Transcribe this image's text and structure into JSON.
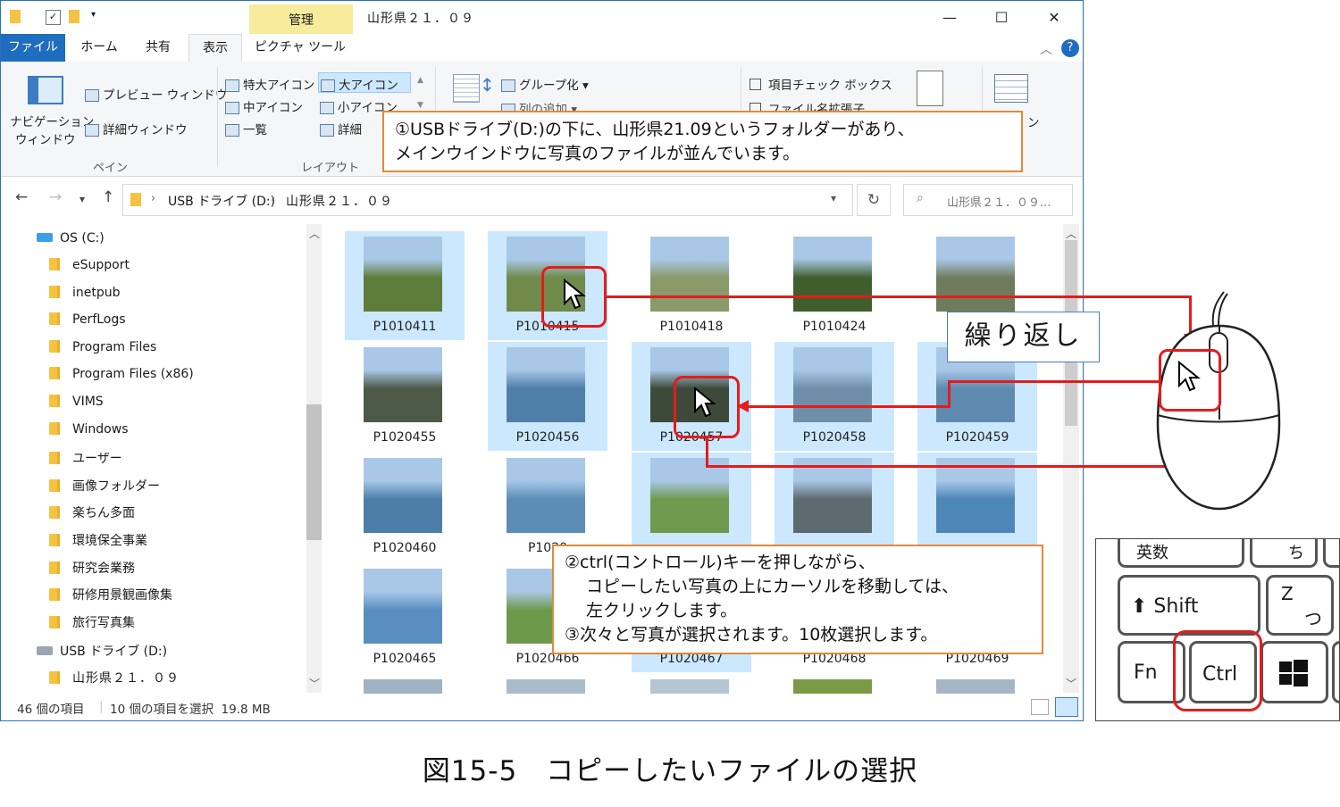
{
  "window": {
    "title": "山形県２１．０９",
    "context_tab": "管理",
    "caption_minimize": "—",
    "caption_maximize": "☐",
    "caption_close": "✕"
  },
  "ribbon_tabs": [
    "ファイル",
    "ホーム",
    "共有",
    "表示",
    "ピクチャ ツール"
  ],
  "ribbon": {
    "navigation_pane_line1": "ナビゲーション",
    "navigation_pane_line2": "ウィンドウ",
    "preview_pane": "プレビュー ウィンドウ",
    "details_pane": "詳細ウィンドウ",
    "pane_group": "ペイン",
    "extra_large_icons": "特大アイコン",
    "large_icons": "大アイコン",
    "medium_icons": "中アイコン",
    "small_icons": "小アイコン",
    "list": "一覧",
    "details": "詳細",
    "layout_group": "レイアウト",
    "group_by": "グループ化",
    "add_columns": "列の追加",
    "item_checkboxes": "項目チェック ボックス",
    "file_extensions": "ファイル名拡張子",
    "options_partial": "ン"
  },
  "address": {
    "drive": "USB ドライブ (D:)",
    "folder": "山形県２１．０９",
    "search_placeholder": "山形県２１．０９..."
  },
  "nav_pane": {
    "os_drive": "OS (C:)",
    "folders": [
      "eSupport",
      "inetpub",
      "PerfLogs",
      "Program Files",
      "Program Files (x86)",
      "VIMS",
      "Windows",
      "ユーザー",
      "画像フォルダー",
      "楽ちん多面",
      "環境保全事業",
      "研究会業務",
      "研修用景観画像集",
      "旅行写真集"
    ],
    "usb_drive": "USB ドライブ (D:)",
    "usb_folder": "山形県２１．０９"
  },
  "files": [
    {
      "name": "P1010411",
      "selected": true,
      "color": "#5f7d3a"
    },
    {
      "name": "P1010415",
      "selected": true,
      "color": "#6f8a4a"
    },
    {
      "name": "P1010418",
      "selected": false,
      "color": "#8a9a6a"
    },
    {
      "name": "P1010424",
      "selected": false,
      "color": "#3f5e2c"
    },
    {
      "name": "",
      "selected": false,
      "color": "#6f7c5c"
    },
    {
      "name": "P1020455",
      "selected": false,
      "color": "#4d5a48"
    },
    {
      "name": "P1020456",
      "selected": true,
      "color": "#4f7ea8"
    },
    {
      "name": "P1020457",
      "selected": true,
      "color": "#3d4a3a"
    },
    {
      "name": "P1020458",
      "selected": true,
      "color": "#6f8fa8"
    },
    {
      "name": "P1020459",
      "selected": true,
      "color": "#5e8ab0"
    },
    {
      "name": "P1020460",
      "selected": false,
      "color": "#4d7eaa"
    },
    {
      "name": "P1020",
      "selected": false,
      "color": "#5b8db6"
    },
    {
      "name": "",
      "selected": true,
      "color": "#6f9a4e"
    },
    {
      "name": "",
      "selected": true,
      "color": "#5c6b70"
    },
    {
      "name": "",
      "selected": true,
      "color": "#4f86b8"
    },
    {
      "name": "P1020465",
      "selected": false,
      "color": "#5a8ec0"
    },
    {
      "name": "P1020466",
      "selected": false,
      "color": "#6d9a4a"
    },
    {
      "name": "P1020467",
      "selected": true,
      "color": "#ffffff"
    },
    {
      "name": "P1020468",
      "selected": false,
      "color": "#ffffff"
    },
    {
      "name": "P1020469",
      "selected": false,
      "color": "#ffffff"
    }
  ],
  "status": {
    "item_count": "46 個の項目",
    "selection": "10 個の項目を選択  19.8 MB"
  },
  "callouts": {
    "top_line1": "①USBドライブ(D:)の下に、山形県21.09というフォルダーがあり、",
    "top_line2": "メインウインドウに写真のファイルが並んでいます。",
    "repeat": "繰り返し",
    "bottom_line1": "②ctrl(コントロール)キーを押しながら、",
    "bottom_line2": "コピーしたい写真の上にカーソルを移動しては、",
    "bottom_line3": "左クリックします。",
    "bottom_line4": "③次々と写真が選択されます。10枚選択します。"
  },
  "keyboard": {
    "eisu": "英数",
    "chi": "ち",
    "shift": "⬆ Shift",
    "z": "Z",
    "tsu": "つ",
    "fn": "Fn",
    "ctrl": "Ctrl"
  },
  "caption": "図15-5　コピーしたいファイルの選択",
  "colors": {
    "accent": "#1f6dbf",
    "selection": "#cce8ff",
    "highlight_red": "#e41c1c",
    "callout_border": "#e08a3c"
  }
}
